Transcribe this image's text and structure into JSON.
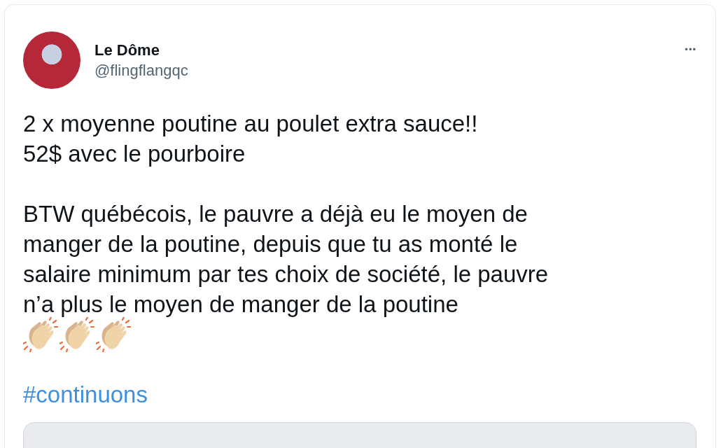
{
  "tweet": {
    "author_name": "Le Dôme",
    "handle": "@flingflangqc",
    "more_button": "•••",
    "paragraphs": [
      [
        "2 x moyenne poutine au poulet extra sauce!!",
        "52$ avec le pourboire"
      ],
      [
        "BTW québécois, le pauvre a déjà eu le moyen de",
        "manger de la poutine, depuis que tu as monté le",
        "salaire minimum par tes choix de société, le pauvre",
        "n’a plus le moyen de manger de la poutine"
      ]
    ],
    "hashtag": "#continuons"
  }
}
